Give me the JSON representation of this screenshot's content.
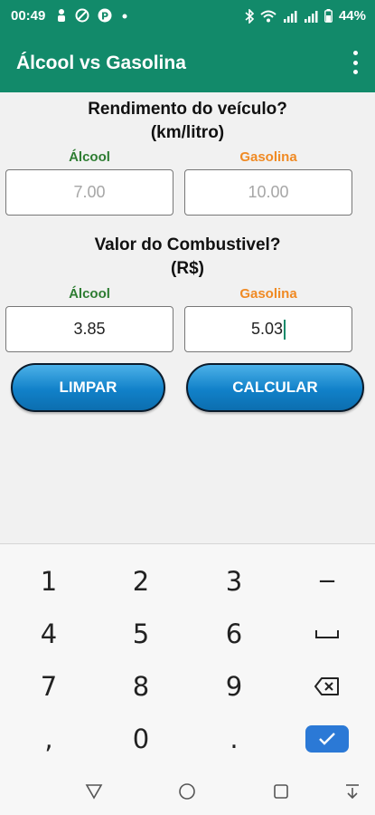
{
  "status": {
    "time": "00:49",
    "battery": "44%"
  },
  "app": {
    "title": "Álcool vs Gasolina"
  },
  "rendimento": {
    "title_line1": "Rendimento do veículo?",
    "title_line2": "(km/litro)",
    "alcool_label": "Álcool",
    "gasolina_label": "Gasolina",
    "alcool_placeholder": "7.00",
    "gasolina_placeholder": "10.00"
  },
  "valor": {
    "title_line1": "Valor do Combustivel?",
    "title_line2": "(R$)",
    "alcool_label": "Álcool",
    "gasolina_label": "Gasolina",
    "alcool_value": "3.85",
    "gasolina_value": "5.03"
  },
  "buttons": {
    "limpar": "LIMPAR",
    "calcular": "CALCULAR"
  },
  "keyboard": {
    "rows": [
      [
        "1",
        "2",
        "3",
        "−"
      ],
      [
        "4",
        "5",
        "6",
        "space"
      ],
      [
        "7",
        "8",
        "9",
        "backspace"
      ],
      [
        ",",
        "0",
        ".",
        "done"
      ]
    ]
  },
  "colors": {
    "primary": "#128a6a",
    "alcool": "#2e7d32",
    "gasolina": "#f08a24",
    "button": "#1181c9",
    "done_key": "#2b79d6"
  }
}
